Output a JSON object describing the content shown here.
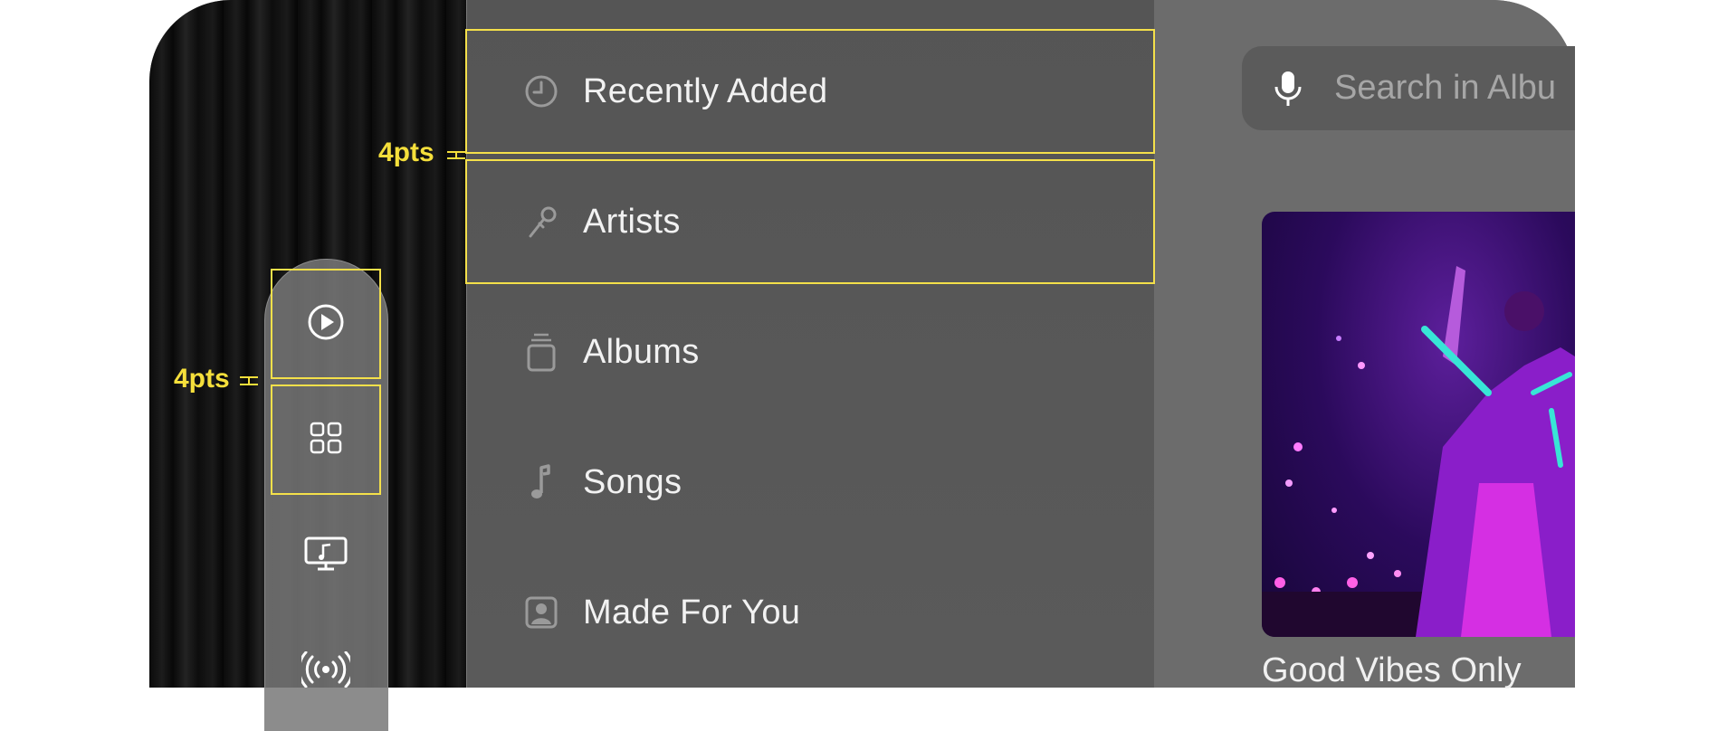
{
  "annotations": {
    "spacing_top": "4pts",
    "spacing_left": "4pts",
    "highlight_color": "#f4e04a"
  },
  "library": {
    "items": [
      {
        "label": "Recently Added",
        "icon": "clock-icon"
      },
      {
        "label": "Artists",
        "icon": "microphone-icon"
      },
      {
        "label": "Albums",
        "icon": "albums-stack-icon"
      },
      {
        "label": "Songs",
        "icon": "music-note-icon"
      },
      {
        "label": "Made For You",
        "icon": "person-square-icon"
      }
    ]
  },
  "tabbar": {
    "tabs": [
      {
        "name": "Play",
        "icon": "play-circle-icon"
      },
      {
        "name": "Browse",
        "icon": "grid-icon"
      },
      {
        "name": "Video",
        "icon": "display-music-icon"
      },
      {
        "name": "Radio",
        "icon": "broadcast-icon"
      }
    ]
  },
  "search": {
    "placeholder": "Search in Albu"
  },
  "content": {
    "album_title": "Good Vibes Only"
  }
}
